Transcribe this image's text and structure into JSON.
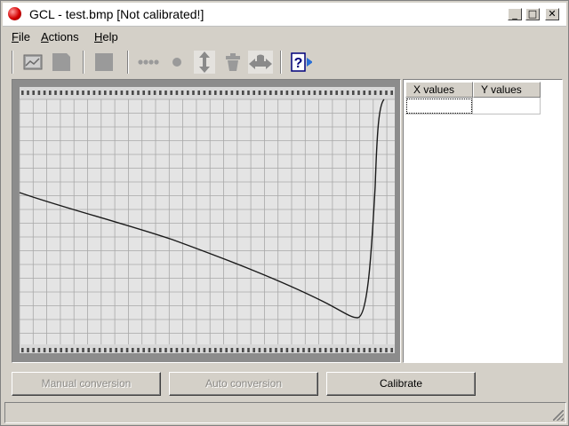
{
  "window": {
    "title": "GCL - test.bmp  [Not calibrated!]",
    "minimize_glyph": "_",
    "maximize_glyph": "□",
    "close_glyph": "✕"
  },
  "menu": {
    "items": [
      {
        "accel": "F",
        "rest": "ile"
      },
      {
        "accel": "A",
        "rest": "ctions"
      },
      {
        "accel": "H",
        "rest": "elp"
      }
    ]
  },
  "toolbar": {
    "icons": [
      "open-image-icon",
      "save-icon",
      "stop-icon",
      "dotted-line-icon",
      "point-icon",
      "vertical-arrows-icon",
      "trash-icon",
      "horizontal-arrows-icon",
      "help-icon"
    ],
    "help_glyph": "?"
  },
  "table": {
    "headers": [
      "X values",
      "Y values"
    ],
    "rows": [
      [
        "",
        ""
      ]
    ]
  },
  "buttons": {
    "manual_conversion": "Manual conversion",
    "auto_conversion": "Auto conversion",
    "calibrate": "Calibrate"
  },
  "status": {
    "text": ""
  },
  "colors": {
    "window_bg": "#d4d0c8",
    "panel_bg": "#8c8c8c",
    "paper_bg": "#e4e4e4",
    "grid": "#a8a8a8",
    "curve": "#1a1a1a"
  }
}
